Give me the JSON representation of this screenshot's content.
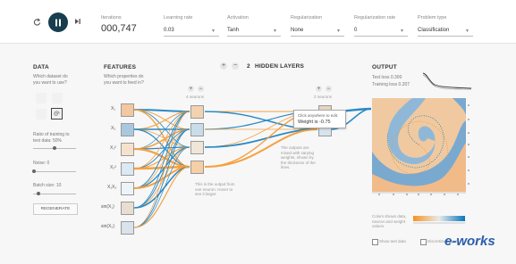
{
  "controls": {
    "reset_icon": "reset-icon",
    "play_icon": "pause-icon",
    "step_icon": "step-icon"
  },
  "top": {
    "iterations_label": "Iterations",
    "iterations_value": "000,747",
    "learning_rate_label": "Learning rate",
    "learning_rate_value": "0.03",
    "activation_label": "Activation",
    "activation_value": "Tanh",
    "regularization_label": "Regularization",
    "regularization_value": "None",
    "reg_rate_label": "Regularization rate",
    "reg_rate_value": "0",
    "problem_label": "Problem type",
    "problem_value": "Classification"
  },
  "data": {
    "title": "DATA",
    "subtitle": "Which dataset do you want to use?",
    "ratio_label": "Ratio of training to test data: 50%",
    "noise_label": "Noise: 0",
    "batch_label": "Batch size: 10",
    "regenerate": "REGENERATE"
  },
  "features": {
    "title": "FEATURES",
    "subtitle": "Which properties do you want to feed in?",
    "items": [
      "X₁",
      "X₂",
      "X₁²",
      "X₂²",
      "X₁X₂",
      "sin(X₁)",
      "sin(X₂)"
    ]
  },
  "hidden": {
    "title": "HIDDEN LAYERS",
    "count": "2",
    "layer1_label": "4 neurons",
    "layer2_label": "2 neurons",
    "note1": "This is the output from one neuron. Hover to see it larger.",
    "note2": "The outputs are mixed with varying weights, shown by the thickness of the lines.",
    "tooltip_line1": "Click anywhere to edit.",
    "tooltip_line2": "Weight is -0.75"
  },
  "output": {
    "title": "OUTPUT",
    "test_loss": "Test loss 0.300",
    "training_loss": "Training loss 0.207",
    "legend_note": "Colors shows data, neuron and weight values.",
    "show_test": "Show test data",
    "discretize": "Discretize output",
    "colors": {
      "orange": "#f59322",
      "blue": "#0877bd"
    }
  },
  "watermark": "e-works"
}
